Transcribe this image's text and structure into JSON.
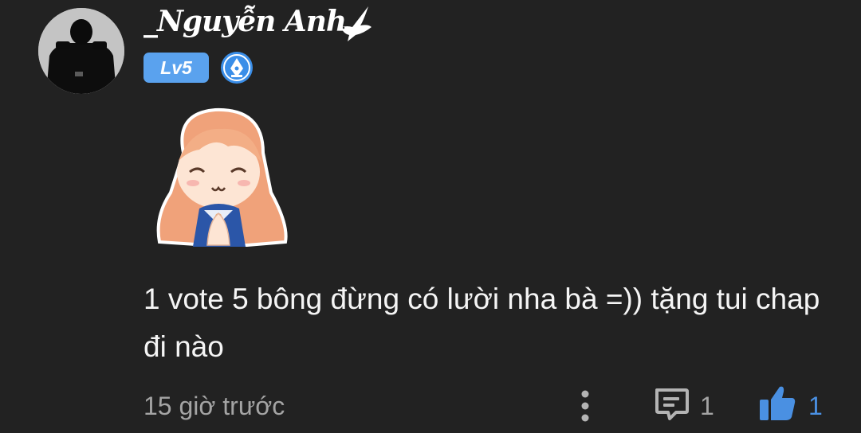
{
  "user": {
    "name": "_Nguyễn Anh",
    "level": "Lv5"
  },
  "comment": {
    "text": "1 vote 5 bông đừng có lười nha bà =)) tặng tui chap đi nào",
    "timestamp": "15 giờ trước",
    "reply_count": "1",
    "like_count": "1"
  },
  "icons": {
    "avatar": "avatar",
    "name_decoration": "dove-icon",
    "badge": "pen-badge-icon",
    "sticker": "anime-girl-praying-sticker",
    "more": "more-vertical-icon",
    "reply": "reply-comment-icon",
    "like": "thumbs-up-icon"
  },
  "colors": {
    "background": "#222222",
    "level_badge": "#5aa2ee",
    "like_accent": "#4a90e2",
    "muted_text": "#a4a4a4"
  }
}
